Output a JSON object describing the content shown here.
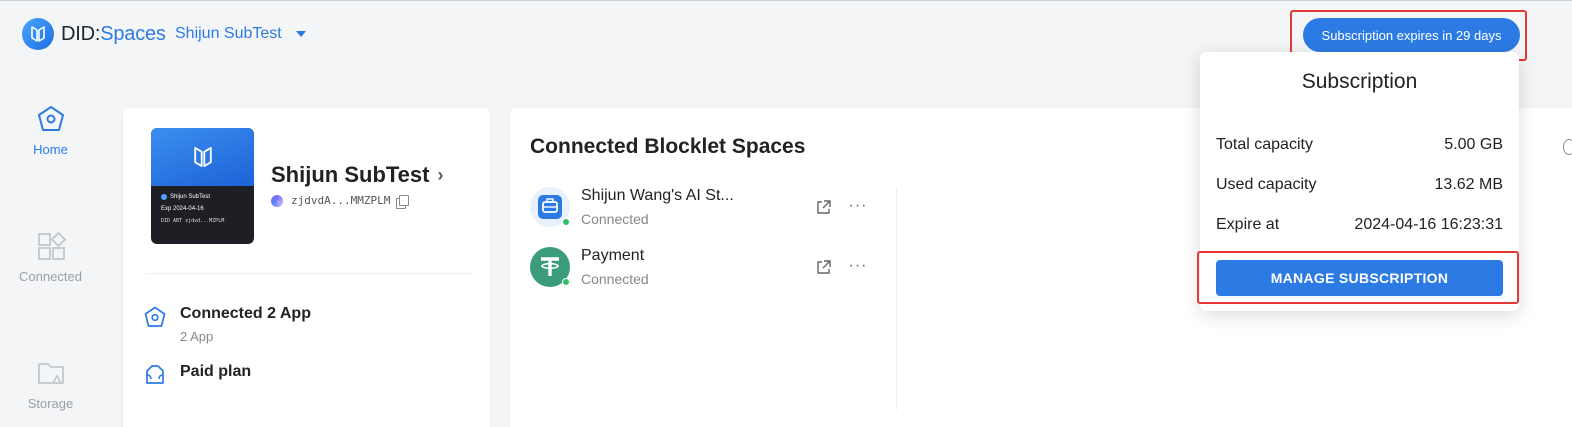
{
  "header": {
    "logo_prefix": "DID:",
    "logo_suffix": "Spaces",
    "space_switch": "Shijun SubTest",
    "subscription_chip": "Subscription expires in 29 days"
  },
  "nav": [
    {
      "label": "Home",
      "icon": "home-icon",
      "active": true
    },
    {
      "label": "Connected",
      "icon": "apps-icon",
      "active": false
    },
    {
      "label": "Storage",
      "icon": "folder-icon",
      "active": false
    }
  ],
  "space": {
    "name": "Shijun SubTest",
    "did": "zjdvdA...MMZPLM",
    "thumb": {
      "name": "Shijun SubTest",
      "exp": "Exp 2024-04-16",
      "did": "DID ABT zjdvd...MZPLM"
    },
    "stats": [
      {
        "title": "Connected 2 App",
        "sub": "2 App",
        "icon": "home-outline-icon"
      },
      {
        "title": "Paid plan",
        "sub": "",
        "icon": "wallet-icon"
      }
    ]
  },
  "connected": {
    "title": "Connected Blocklet Spaces",
    "items": [
      {
        "name": "Shijun Wang's AI St...",
        "state": "Connected",
        "icon": "ai-studio-icon",
        "color": "#2c7be5"
      },
      {
        "name": "Payment",
        "state": "Connected",
        "icon": "tether-icon",
        "color": "#3a9c7a"
      }
    ]
  },
  "popover": {
    "title": "Subscription",
    "rows": [
      {
        "label": "Total capacity",
        "value": "5.00 GB"
      },
      {
        "label": "Used capacity",
        "value": "13.62 MB"
      },
      {
        "label": "Expire at",
        "value": "2024-04-16 16:23:31"
      }
    ],
    "button": "MANAGE SUBSCRIPTION"
  },
  "colors": {
    "accent": "#2c7be5",
    "highlight": "#e53935",
    "status": "#2bbf6a"
  }
}
